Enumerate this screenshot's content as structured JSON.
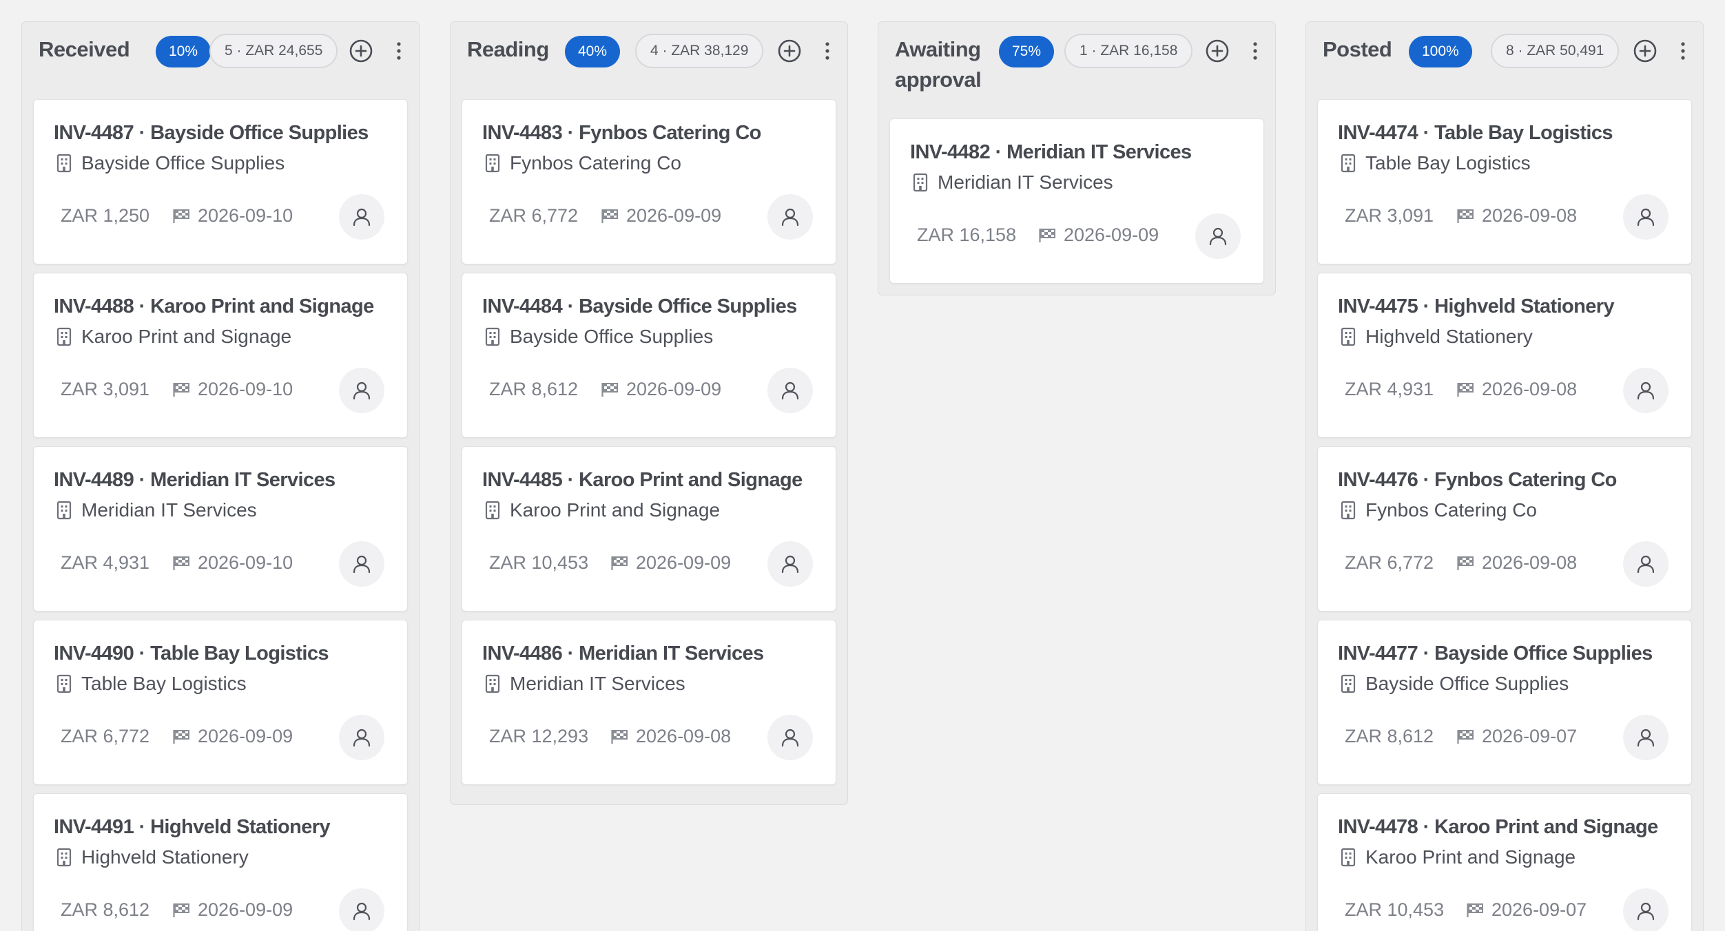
{
  "columns": [
    {
      "title": "Received",
      "percent": "10%",
      "summary": "5 · ZAR 24,655",
      "cards": [
        {
          "title": "INV-4487 · Bayside Office Supplies",
          "vendor": "Bayside Office Supplies",
          "amount": "ZAR 1,250",
          "date": "2026-09-10"
        },
        {
          "title": "INV-4488 · Karoo Print and Signage",
          "vendor": "Karoo Print and Signage",
          "amount": "ZAR 3,091",
          "date": "2026-09-10"
        },
        {
          "title": "INV-4489 · Meridian IT Services",
          "vendor": "Meridian IT Services",
          "amount": "ZAR 4,931",
          "date": "2026-09-10"
        },
        {
          "title": "INV-4490 · Table Bay Logistics",
          "vendor": "Table Bay Logistics",
          "amount": "ZAR 6,772",
          "date": "2026-09-09"
        },
        {
          "title": "INV-4491 · Highveld Stationery",
          "vendor": "Highveld Stationery",
          "amount": "ZAR 8,612",
          "date": "2026-09-09"
        }
      ]
    },
    {
      "title": "Reading",
      "percent": "40%",
      "summary": "4 · ZAR 38,129",
      "cards": [
        {
          "title": "INV-4483 · Fynbos Catering Co",
          "vendor": "Fynbos Catering Co",
          "amount": "ZAR 6,772",
          "date": "2026-09-09"
        },
        {
          "title": "INV-4484 · Bayside Office Supplies",
          "vendor": "Bayside Office Supplies",
          "amount": "ZAR 8,612",
          "date": "2026-09-09"
        },
        {
          "title": "INV-4485 · Karoo Print and Signage",
          "vendor": "Karoo Print and Signage",
          "amount": "ZAR 10,453",
          "date": "2026-09-09"
        },
        {
          "title": "INV-4486 · Meridian IT Services",
          "vendor": "Meridian IT Services",
          "amount": "ZAR 12,293",
          "date": "2026-09-08"
        }
      ]
    },
    {
      "title": "Awaiting approval",
      "percent": "75%",
      "summary": "1 · ZAR 16,158",
      "cards": [
        {
          "title": "INV-4482 · Meridian IT Services",
          "vendor": "Meridian IT Services",
          "amount": "ZAR 16,158",
          "date": "2026-09-09"
        }
      ]
    },
    {
      "title": "Posted",
      "percent": "100%",
      "summary": "8 · ZAR 50,491",
      "cards": [
        {
          "title": "INV-4474 · Table Bay Logistics",
          "vendor": "Table Bay Logistics",
          "amount": "ZAR 3,091",
          "date": "2026-09-08"
        },
        {
          "title": "INV-4475 · Highveld Stationery",
          "vendor": "Highveld Stationery",
          "amount": "ZAR 4,931",
          "date": "2026-09-08"
        },
        {
          "title": "INV-4476 · Fynbos Catering Co",
          "vendor": "Fynbos Catering Co",
          "amount": "ZAR 6,772",
          "date": "2026-09-08"
        },
        {
          "title": "INV-4477 · Bayside Office Supplies",
          "vendor": "Bayside Office Supplies",
          "amount": "ZAR 8,612",
          "date": "2026-09-07"
        },
        {
          "title": "INV-4478 · Karoo Print and Signage",
          "vendor": "Karoo Print and Signage",
          "amount": "ZAR 10,453",
          "date": "2026-09-07"
        }
      ]
    }
  ],
  "icons": {
    "add": "plus-circle-icon",
    "more": "more-vertical-icon",
    "vendor": "building-icon",
    "date": "flag-icon",
    "assignee": "user-icon"
  },
  "colors": {
    "accent": "#1766cf",
    "background": "#f2f2f3",
    "column": "#ececed",
    "card": "#ffffff"
  }
}
